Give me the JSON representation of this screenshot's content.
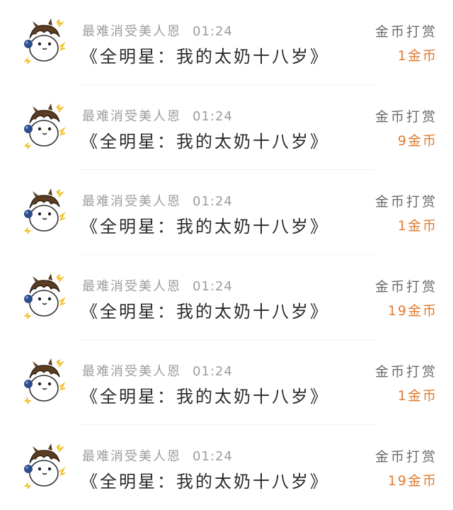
{
  "colors": {
    "accent": "#e07b2f",
    "meta_text": "#9c9c9c",
    "title_text": "#2a2a2a",
    "action_text": "#6a6a6a"
  },
  "rows": [
    {
      "avatar_icon": "cartoon-avatar-icon",
      "username": "最难消受美人恩",
      "time": "01:24",
      "title": "《全明星：我的太奶十八岁》",
      "action": "金币打赏",
      "amount": "1金币"
    },
    {
      "avatar_icon": "cartoon-avatar-icon",
      "username": "最难消受美人恩",
      "time": "01:24",
      "title": "《全明星：我的太奶十八岁》",
      "action": "金币打赏",
      "amount": "9金币"
    },
    {
      "avatar_icon": "cartoon-avatar-icon",
      "username": "最难消受美人恩",
      "time": "01:24",
      "title": "《全明星：我的太奶十八岁》",
      "action": "金币打赏",
      "amount": "1金币"
    },
    {
      "avatar_icon": "cartoon-avatar-icon",
      "username": "最难消受美人恩",
      "time": "01:24",
      "title": "《全明星：我的太奶十八岁》",
      "action": "金币打赏",
      "amount": "19金币"
    },
    {
      "avatar_icon": "cartoon-avatar-icon",
      "username": "最难消受美人恩",
      "time": "01:24",
      "title": "《全明星：我的太奶十八岁》",
      "action": "金币打赏",
      "amount": "1金币"
    },
    {
      "avatar_icon": "cartoon-avatar-icon",
      "username": "最难消受美人恩",
      "time": "01:24",
      "title": "《全明星：我的太奶十八岁》",
      "action": "金币打赏",
      "amount": "19金币"
    }
  ]
}
